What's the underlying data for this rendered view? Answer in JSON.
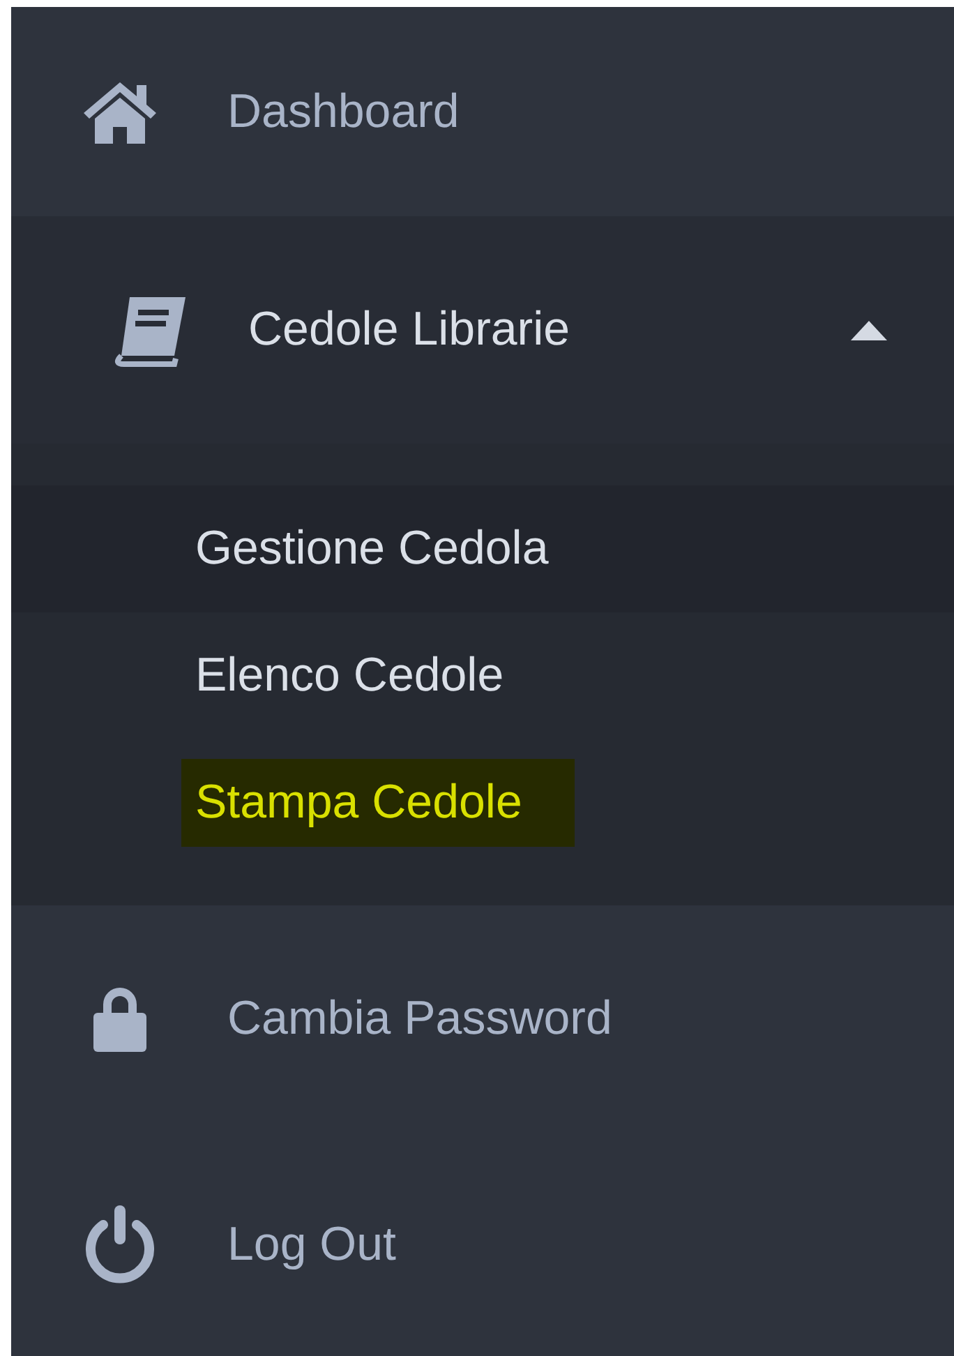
{
  "menu": {
    "items": [
      {
        "kind": "link",
        "label": "Dashboard"
      },
      {
        "kind": "group",
        "label": "Cedole Librarie",
        "expanded": true,
        "children": [
          {
            "label": "Gestione Cedola",
            "hovered": true,
            "selected": false
          },
          {
            "label": "Elenco Cedole",
            "hovered": false,
            "selected": false
          },
          {
            "label": "Stampa Cedole",
            "hovered": false,
            "selected": true
          }
        ]
      },
      {
        "kind": "link",
        "label": "Cambia Password"
      },
      {
        "kind": "link",
        "label": "Log Out"
      }
    ]
  }
}
